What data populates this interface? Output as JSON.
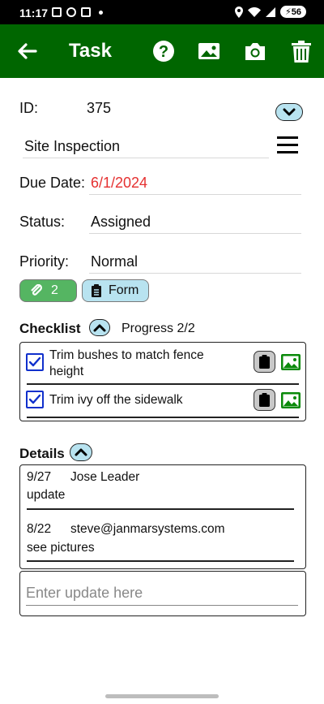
{
  "status_bar": {
    "time": "11:17",
    "battery": "56"
  },
  "app_bar": {
    "title": "Task"
  },
  "task": {
    "id_label": "ID:",
    "id_value": "375",
    "name": "Site Inspection",
    "due_label": "Due Date:",
    "due_value": "6/1/2024",
    "status_label": "Status:",
    "status_value": "Assigned",
    "priority_label": "Priority:",
    "priority_value": "Normal"
  },
  "chips": {
    "attachments_count": "2",
    "form_label": "Form"
  },
  "checklist": {
    "title": "Checklist",
    "progress": "Progress  2/2",
    "items": [
      {
        "label": "Trim bushes to match fence height",
        "checked": true
      },
      {
        "label": "Trim ivy off the sidewalk",
        "checked": true
      }
    ]
  },
  "details": {
    "title": "Details",
    "entries": [
      {
        "date": "9/27",
        "author": "Jose Leader",
        "text": "update"
      },
      {
        "date": "8/22",
        "author": "steve@janmarsystems.com",
        "text": "see pictures"
      }
    ],
    "input_placeholder": "Enter update here"
  },
  "colors": {
    "app_bar": "#006600",
    "due_date": "#e53030",
    "attach_chip": "#55b562",
    "form_chip": "#b8e3f0",
    "checkbox": "#1030cc",
    "image_icon": "#0a8a0a"
  }
}
